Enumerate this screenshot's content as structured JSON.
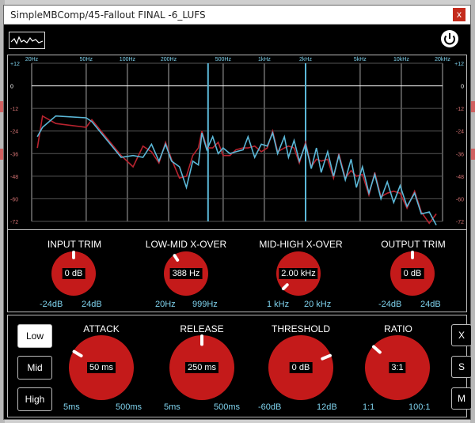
{
  "window": {
    "title": "SimpleMBComp/45-Fallout FINAL -6_LUFS",
    "close_label": "x"
  },
  "spectrum": {
    "freq_ticks": [
      "20Hz",
      "50Hz",
      "100Hz",
      "200Hz",
      "500Hz",
      "1kHz",
      "2kHz",
      "5kHz",
      "10kHz",
      "20kHz"
    ],
    "db_ticks": [
      "+12",
      "0",
      "-12",
      "-24",
      "-36",
      "-48",
      "-60",
      "-72"
    ],
    "colors": {
      "left": "#b8232f",
      "right": "#5bb8d8",
      "grid": "#555555",
      "zero_line": "#ffffff"
    }
  },
  "io": {
    "input_trim": {
      "label": "INPUT TRIM",
      "value": "0 dB",
      "min": "-24dB",
      "max": "24dB"
    },
    "low_mid": {
      "label": "LOW-MID X-OVER",
      "value": "388 Hz",
      "min": "20Hz",
      "max": "999Hz"
    },
    "mid_high": {
      "label": "MID-HIGH X-OVER",
      "value": "2.00 kHz",
      "min": "1 kHz",
      "max": "20 kHz"
    },
    "output_trim": {
      "label": "OUTPUT TRIM",
      "value": "0 dB",
      "min": "-24dB",
      "max": "24dB"
    }
  },
  "bands": {
    "buttons": [
      "Low",
      "Mid",
      "High"
    ],
    "active": "Low",
    "side_buttons": [
      "X",
      "S",
      "M"
    ]
  },
  "band_controls": {
    "attack": {
      "label": "ATTACK",
      "value": "50 ms",
      "min": "5ms",
      "max": "500ms"
    },
    "release": {
      "label": "RELEASE",
      "value": "250 ms",
      "min": "5ms",
      "max": "500ms"
    },
    "threshold": {
      "label": "THRESHOLD",
      "value": "0 dB",
      "min": "-60dB",
      "max": "12dB"
    },
    "ratio": {
      "label": "RATIO",
      "value": "3:1",
      "min": "1:1",
      "max": "100:1"
    }
  },
  "knob_color": "#c41a1a"
}
